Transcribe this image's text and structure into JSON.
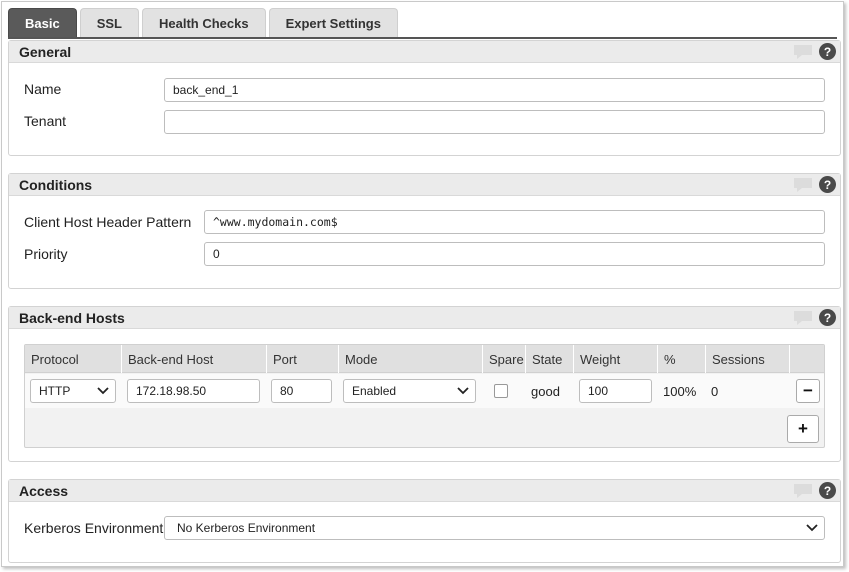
{
  "tabs": [
    {
      "label": "Basic",
      "active": true
    },
    {
      "label": "SSL",
      "active": false
    },
    {
      "label": "Health Checks",
      "active": false
    },
    {
      "label": "Expert Settings",
      "active": false
    }
  ],
  "general": {
    "title": "General",
    "name_label": "Name",
    "name_value": "back_end_1",
    "tenant_label": "Tenant",
    "tenant_value": ""
  },
  "conditions": {
    "title": "Conditions",
    "host_pattern_label": "Client Host Header Pattern",
    "host_pattern_value": "^www.mydomain.com$",
    "priority_label": "Priority",
    "priority_value": "0"
  },
  "backend_hosts": {
    "title": "Back-end Hosts",
    "columns": [
      "Protocol",
      "Back-end Host",
      "Port",
      "Mode",
      "Spare",
      "State",
      "Weight",
      "%",
      "Sessions"
    ],
    "rows": [
      {
        "protocol": "HTTP",
        "host": "172.18.98.50",
        "port": "80",
        "mode": "Enabled",
        "spare": false,
        "state": "good",
        "weight": "100",
        "percent": "100%",
        "sessions": "0"
      }
    ],
    "remove_label": "−",
    "add_label": "+"
  },
  "access": {
    "title": "Access",
    "kerberos_label": "Kerberos Environment",
    "kerberos_value": "No Kerberos Environment"
  },
  "help_glyph": "?",
  "icons": {
    "comment": "comment-icon",
    "help": "help-icon",
    "dropdown": "chevron-down-icon"
  }
}
